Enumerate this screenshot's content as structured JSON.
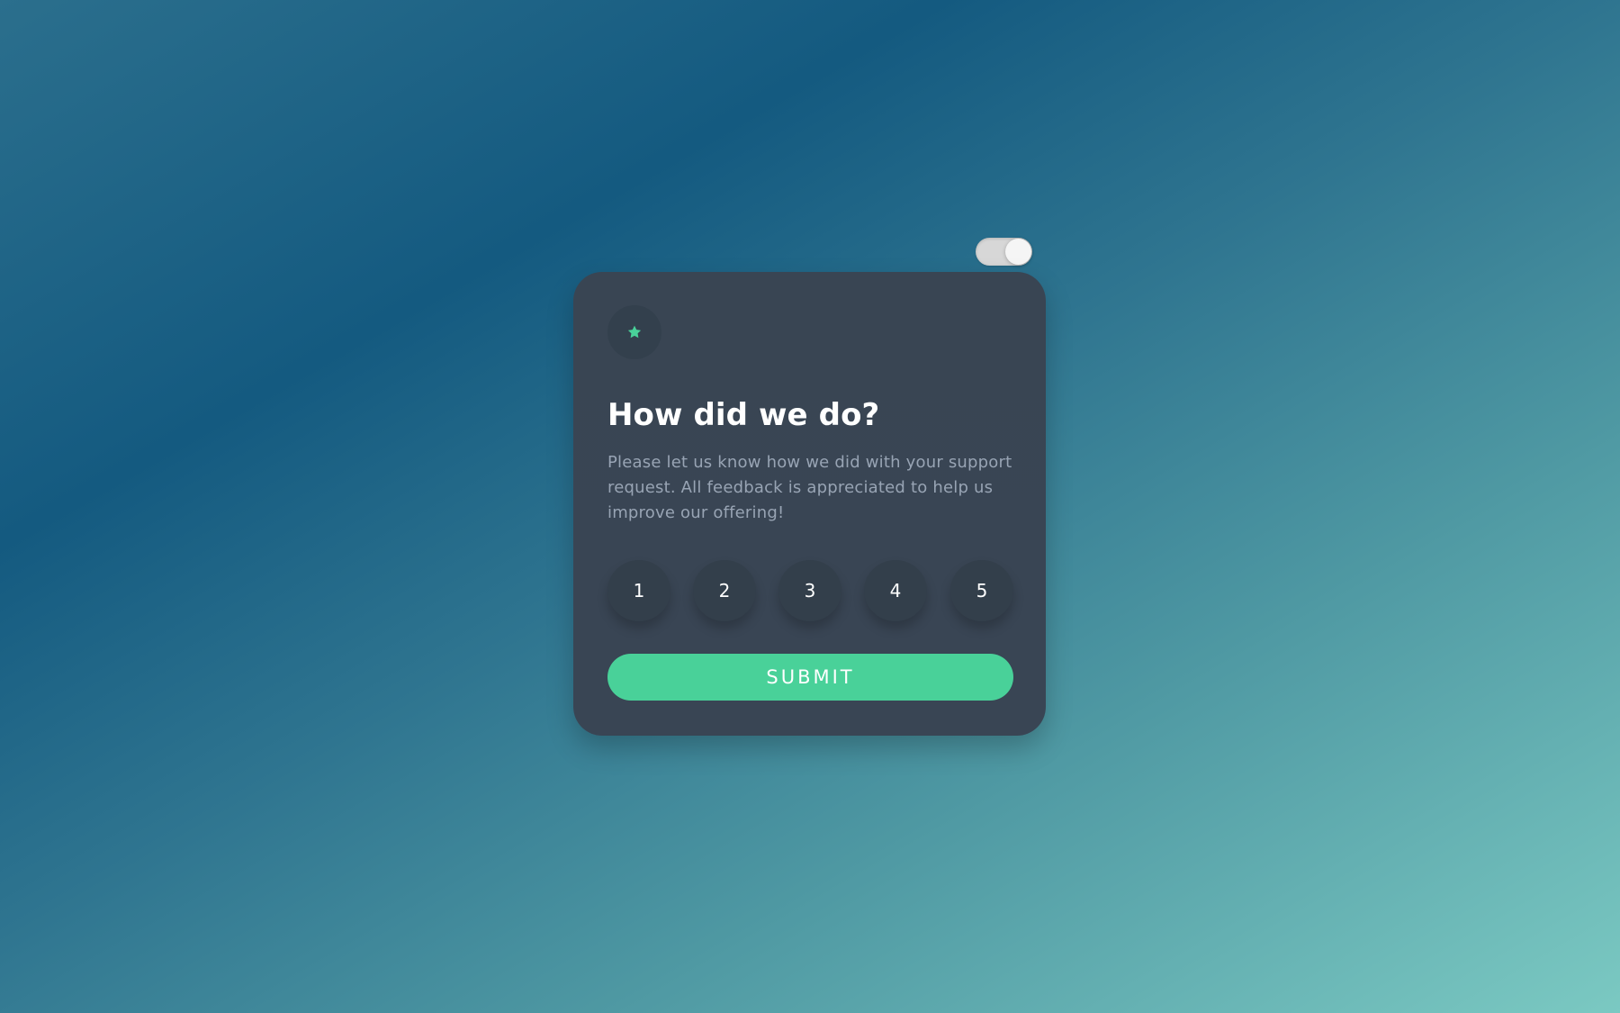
{
  "theme_toggle": {
    "state": "on"
  },
  "card": {
    "icon": "star-icon",
    "title": "How did we do?",
    "description": "Please let us know how we did with your support request. All feedback is appreciated to help us improve our offering!",
    "ratings": [
      {
        "label": "1"
      },
      {
        "label": "2"
      },
      {
        "label": "3"
      },
      {
        "label": "4"
      },
      {
        "label": "5"
      }
    ],
    "submit_label": "SUBMIT"
  },
  "colors": {
    "accent": "#49d199",
    "card_background": "#394553",
    "rating_background": "#333f4b",
    "muted_text": "#98a4b4",
    "toggle_track": "#d7d7d7",
    "toggle_knob": "#f5f5f5"
  }
}
